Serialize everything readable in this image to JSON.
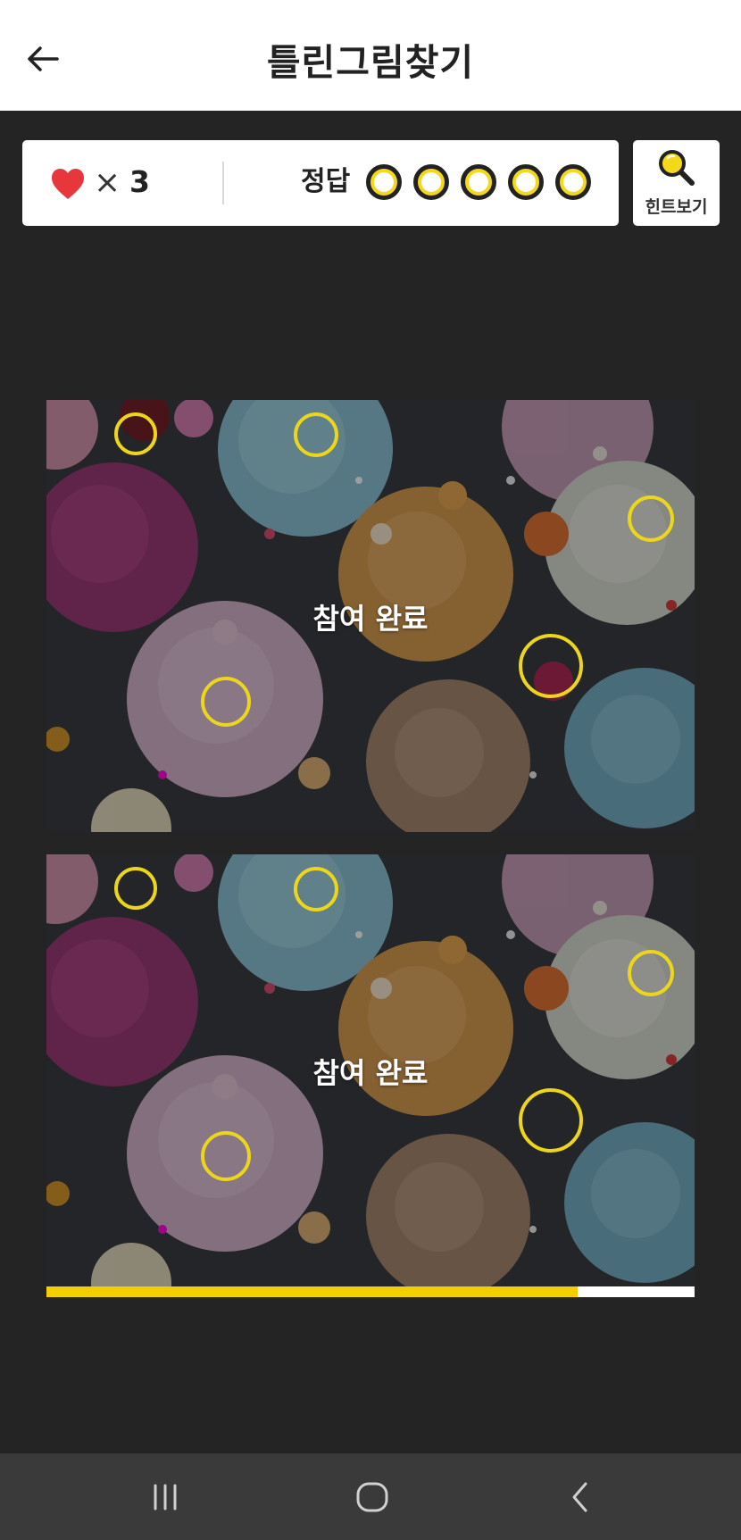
{
  "header": {
    "title": "틀린그림찾기",
    "back_icon": "arrow-left-icon"
  },
  "status": {
    "heart_icon": "heart-icon",
    "heart_color": "#e8363d",
    "times_symbol": "×",
    "lives": "3",
    "answer_label": "정답",
    "answers_found": 0,
    "answers_total": 5,
    "slot_color": "#f6d81a"
  },
  "hint": {
    "label": "힌트보기",
    "icon": "magnifier-icon"
  },
  "puzzles": [
    {
      "overlay_text": "참여 완료"
    },
    {
      "overlay_text": "참여 완료"
    }
  ],
  "marker_color": "#ecd51c",
  "timer": {
    "progress": 0.82,
    "color": "#f2cf00"
  },
  "nav": {
    "recents_icon": "recent-apps-icon",
    "home_icon": "home-icon",
    "back_icon": "nav-back-icon"
  }
}
